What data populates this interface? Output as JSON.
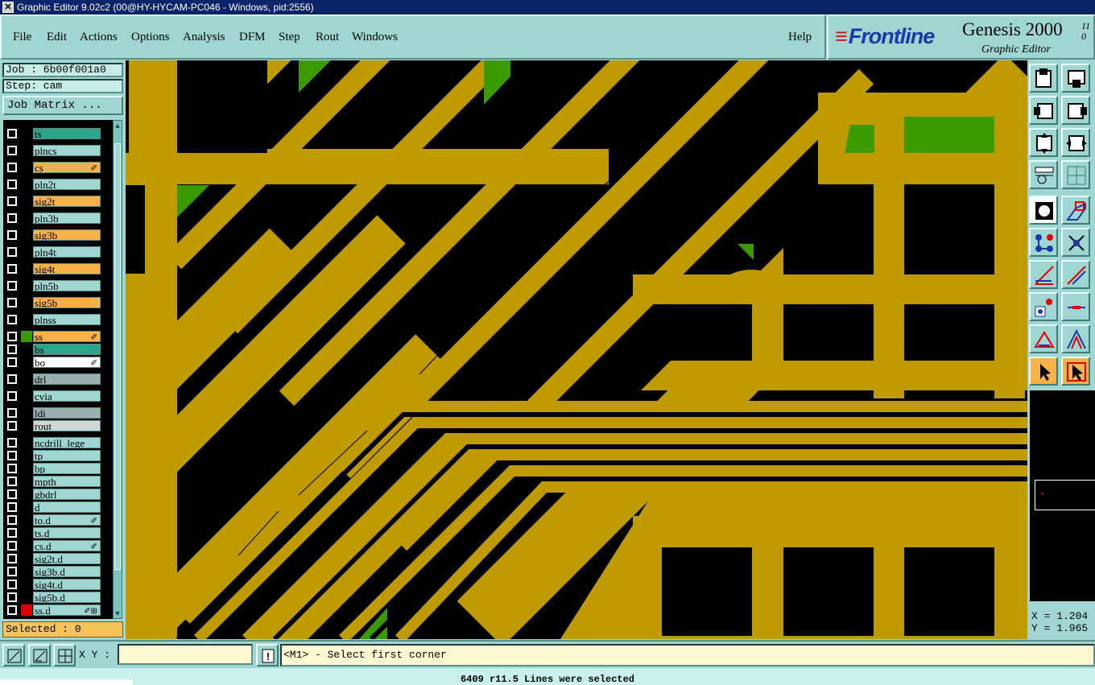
{
  "window": {
    "title": "Graphic Editor 9.02c2 (00@HY-HYCAM-PC046 - Windows, pid:2556)"
  },
  "menu": {
    "items": [
      "File",
      "Edit",
      "Actions",
      "Options",
      "Analysis",
      "DFM",
      "Step",
      "Rout",
      "Windows"
    ],
    "help": "Help"
  },
  "brand": {
    "logo": "Frontline",
    "product": "Genesis 2000",
    "version_top": "11",
    "version_bottom": "0",
    "subtitle": "Graphic Editor"
  },
  "job": {
    "job_label": "Job : 6b00f001a0",
    "step_label": "Step: cam",
    "matrix_button": "Job Matrix ..."
  },
  "colors": {
    "copper": "#bf9a00",
    "green": "#3b9a00",
    "signal_orange": "#f6b24a",
    "teal_layer": "#2aa58c",
    "red": "#e00000",
    "panel": "#9fd6d2"
  },
  "layers": [
    {
      "name": "ts",
      "bg": "#2aa58c",
      "swatch": "#000",
      "mark": ""
    },
    {
      "name": "plncs",
      "bg": "#9fd6d2",
      "swatch": "#000",
      "mark": ""
    },
    {
      "name": "cs",
      "bg": "#f6b24a",
      "swatch": "#000",
      "mark": "✐"
    },
    {
      "name": "pln2t",
      "bg": "#9fd6d2",
      "swatch": "#000",
      "mark": ""
    },
    {
      "name": "sig2t",
      "bg": "#f6b24a",
      "swatch": "#000",
      "mark": ""
    },
    {
      "name": "pln3b",
      "bg": "#9fd6d2",
      "swatch": "#000",
      "mark": ""
    },
    {
      "name": "sig3b",
      "bg": "#f6b24a",
      "swatch": "#000",
      "mark": ""
    },
    {
      "name": "pln4t",
      "bg": "#9fd6d2",
      "swatch": "#000",
      "mark": ""
    },
    {
      "name": "sig4t",
      "bg": "#f6b24a",
      "swatch": "#000",
      "mark": ""
    },
    {
      "name": "pln5b",
      "bg": "#9fd6d2",
      "swatch": "#000",
      "mark": ""
    },
    {
      "name": "sig5b",
      "bg": "#f6b24a",
      "swatch": "#000",
      "mark": ""
    },
    {
      "name": "plnss",
      "bg": "#9fd6d2",
      "swatch": "#000",
      "mark": ""
    },
    {
      "name": "ss",
      "bg": "#f6b24a",
      "swatch": "#3b9a00",
      "mark": "✐"
    },
    {
      "name": "bs",
      "bg": "#2aa58c",
      "swatch": "#000",
      "mark": ""
    },
    {
      "name": "bo",
      "bg": "#ffffff",
      "swatch": "#000",
      "mark": "✐"
    },
    {
      "name": "drl",
      "bg": "#9ab0b0",
      "swatch": "#000",
      "mark": ""
    },
    {
      "name": "cvia",
      "bg": "#9fd6d2",
      "swatch": "#000",
      "mark": ""
    },
    {
      "name": "ldi",
      "bg": "#9ab0b0",
      "swatch": "#000",
      "mark": ""
    },
    {
      "name": "rout",
      "bg": "#d0d8d8",
      "swatch": "#000",
      "mark": ""
    },
    {
      "name": "ncdrill_lege",
      "bg": "#9fd6d2",
      "swatch": "#000",
      "mark": ""
    },
    {
      "name": "tp",
      "bg": "#9fd6d2",
      "swatch": "#000",
      "mark": ""
    },
    {
      "name": "bp",
      "bg": "#9fd6d2",
      "swatch": "#000",
      "mark": ""
    },
    {
      "name": "mpth",
      "bg": "#9fd6d2",
      "swatch": "#000",
      "mark": ""
    },
    {
      "name": "gbdrl",
      "bg": "#9fd6d2",
      "swatch": "#000",
      "mark": ""
    },
    {
      "name": "d",
      "bg": "#9fd6d2",
      "swatch": "#000",
      "mark": ""
    },
    {
      "name": "to.d",
      "bg": "#9fd6d2",
      "swatch": "#000",
      "mark": "✐"
    },
    {
      "name": "ts.d",
      "bg": "#9fd6d2",
      "swatch": "#000",
      "mark": ""
    },
    {
      "name": "cs.d",
      "bg": "#9fd6d2",
      "swatch": "#000",
      "mark": "✐"
    },
    {
      "name": "sig2t.d",
      "bg": "#9fd6d2",
      "swatch": "#000",
      "mark": ""
    },
    {
      "name": "sig3b.d",
      "bg": "#9fd6d2",
      "swatch": "#000",
      "mark": ""
    },
    {
      "name": "sig4t.d",
      "bg": "#9fd6d2",
      "swatch": "#000",
      "mark": ""
    },
    {
      "name": "sig5b.d",
      "bg": "#9fd6d2",
      "swatch": "#000",
      "mark": ""
    },
    {
      "name": "ss.d",
      "bg": "#9fd6d2",
      "swatch": "#e00000",
      "mark": "✐⊞"
    }
  ],
  "selected": "Selected : 0",
  "coords": {
    "x": "X = 1.204",
    "y": "Y = 1.965"
  },
  "bottom": {
    "xy_label": "X Y :",
    "xy_value": "",
    "prompt": "<M1> - Select first corner",
    "status": "6409 r11.5 Lines were selected"
  }
}
